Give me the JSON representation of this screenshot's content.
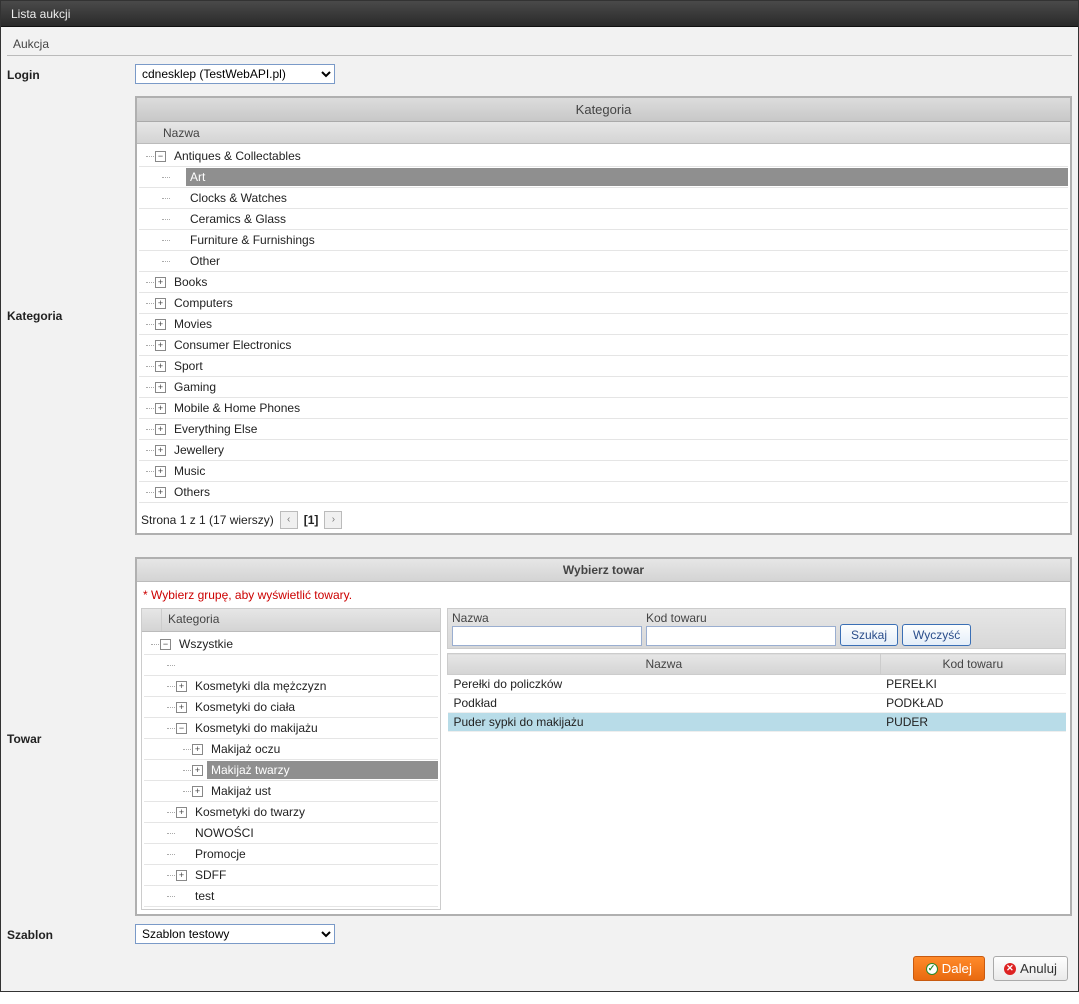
{
  "window": {
    "title": "Lista aukcji"
  },
  "tab": {
    "label": "Aukcja"
  },
  "login": {
    "label": "Login",
    "selected": "cdnesklep (TestWebAPI.pl)"
  },
  "kategoria_section": {
    "label": "Kategoria",
    "panel_title": "Kategoria",
    "column_header": "Nazwa",
    "tree": [
      {
        "label": "Antiques & Collectables",
        "depth": 0,
        "expand": "minus",
        "child_selected": false
      },
      {
        "label": "Art",
        "depth": 1,
        "expand": "none",
        "selected": true
      },
      {
        "label": "Clocks & Watches",
        "depth": 1,
        "expand": "none"
      },
      {
        "label": "Ceramics & Glass",
        "depth": 1,
        "expand": "none"
      },
      {
        "label": "Furniture & Furnishings",
        "depth": 1,
        "expand": "none"
      },
      {
        "label": "Other",
        "depth": 1,
        "expand": "none"
      },
      {
        "label": "Books",
        "depth": 0,
        "expand": "plus"
      },
      {
        "label": "Computers",
        "depth": 0,
        "expand": "plus"
      },
      {
        "label": "Movies",
        "depth": 0,
        "expand": "plus"
      },
      {
        "label": "Consumer Electronics",
        "depth": 0,
        "expand": "plus"
      },
      {
        "label": "Sport",
        "depth": 0,
        "expand": "plus"
      },
      {
        "label": "Gaming",
        "depth": 0,
        "expand": "plus"
      },
      {
        "label": "Mobile & Home Phones",
        "depth": 0,
        "expand": "plus"
      },
      {
        "label": "Everything Else",
        "depth": 0,
        "expand": "plus"
      },
      {
        "label": "Jewellery",
        "depth": 0,
        "expand": "plus"
      },
      {
        "label": "Music",
        "depth": 0,
        "expand": "plus"
      },
      {
        "label": "Others",
        "depth": 0,
        "expand": "plus"
      }
    ],
    "pager": {
      "text": "Strona 1 z 1 (17 wierszy)",
      "current": "[1]"
    }
  },
  "towar_section": {
    "label": "Towar",
    "panel_title": "Wybierz towar",
    "note": "* Wybierz grupę, aby wyświetlić towary.",
    "left_header": "Kategoria",
    "left_tree": [
      {
        "label": "Wszystkie",
        "depth": 0,
        "expand": "minus"
      },
      {
        "label": "",
        "depth": 1,
        "expand": "none",
        "blank": true
      },
      {
        "label": "Kosmetyki dla mężczyzn",
        "depth": 1,
        "expand": "plus"
      },
      {
        "label": "Kosmetyki do ciała",
        "depth": 1,
        "expand": "plus"
      },
      {
        "label": "Kosmetyki do makijażu",
        "depth": 1,
        "expand": "minus"
      },
      {
        "label": "Makijaż oczu",
        "depth": 2,
        "expand": "plus"
      },
      {
        "label": "Makijaż twarzy",
        "depth": 2,
        "expand": "plus",
        "selected": true
      },
      {
        "label": "Makijaż ust",
        "depth": 2,
        "expand": "plus"
      },
      {
        "label": "Kosmetyki do twarzy",
        "depth": 1,
        "expand": "plus"
      },
      {
        "label": "NOWOŚCI",
        "depth": 1,
        "expand": "none"
      },
      {
        "label": "Promocje",
        "depth": 1,
        "expand": "none"
      },
      {
        "label": "SDFF",
        "depth": 1,
        "expand": "plus"
      },
      {
        "label": "test",
        "depth": 1,
        "expand": "none"
      }
    ],
    "search": {
      "name_label": "Nazwa",
      "code_label": "Kod towaru",
      "name_value": "",
      "code_value": "",
      "search_btn": "Szukaj",
      "clear_btn": "Wyczyść"
    },
    "result_columns": {
      "name": "Nazwa",
      "code": "Kod towaru"
    },
    "results": [
      {
        "name": "Perełki do policzków",
        "code": "PEREŁKI"
      },
      {
        "name": "Podkład",
        "code": "PODKŁAD"
      },
      {
        "name": "Puder sypki do makijażu",
        "code": "PUDER",
        "selected": true
      }
    ]
  },
  "szablon": {
    "label": "Szablon",
    "selected": "Szablon testowy"
  },
  "footer": {
    "next": "Dalej",
    "cancel": "Anuluj"
  }
}
